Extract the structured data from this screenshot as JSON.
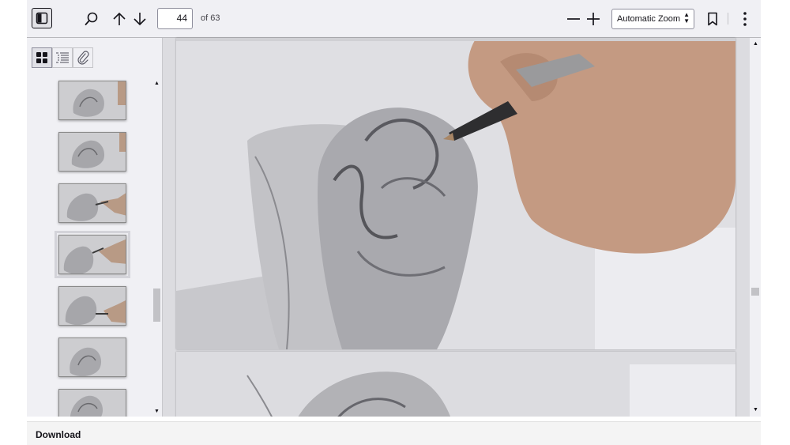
{
  "toolbar": {
    "sidebar_toggle_icon": "sidebar-toggle-icon",
    "search_icon": "search-icon",
    "prev_page_icon": "arrow-up-icon",
    "next_page_icon": "arrow-down-icon",
    "page_number": "44",
    "page_count": "of 63",
    "zoom_out_icon": "minus-icon",
    "zoom_in_icon": "plus-icon",
    "zoom_value": "Automatic Zoom",
    "bookmark_icon": "bookmark-icon",
    "menu_icon": "more-vertical-icon"
  },
  "sidebar": {
    "tabs": [
      {
        "icon": "grid-icon",
        "active": true
      },
      {
        "icon": "outline-list-icon",
        "active": false
      },
      {
        "icon": "paperclip-icon",
        "active": false
      }
    ],
    "thumbnail_count": 7,
    "selected_thumbnail_index": 3
  },
  "footer": {
    "download_label": "Download"
  },
  "colors": {
    "toolbar_bg": "#f0f0f4",
    "viewer_bg": "#d4d4d7",
    "icon": "#15141a"
  }
}
